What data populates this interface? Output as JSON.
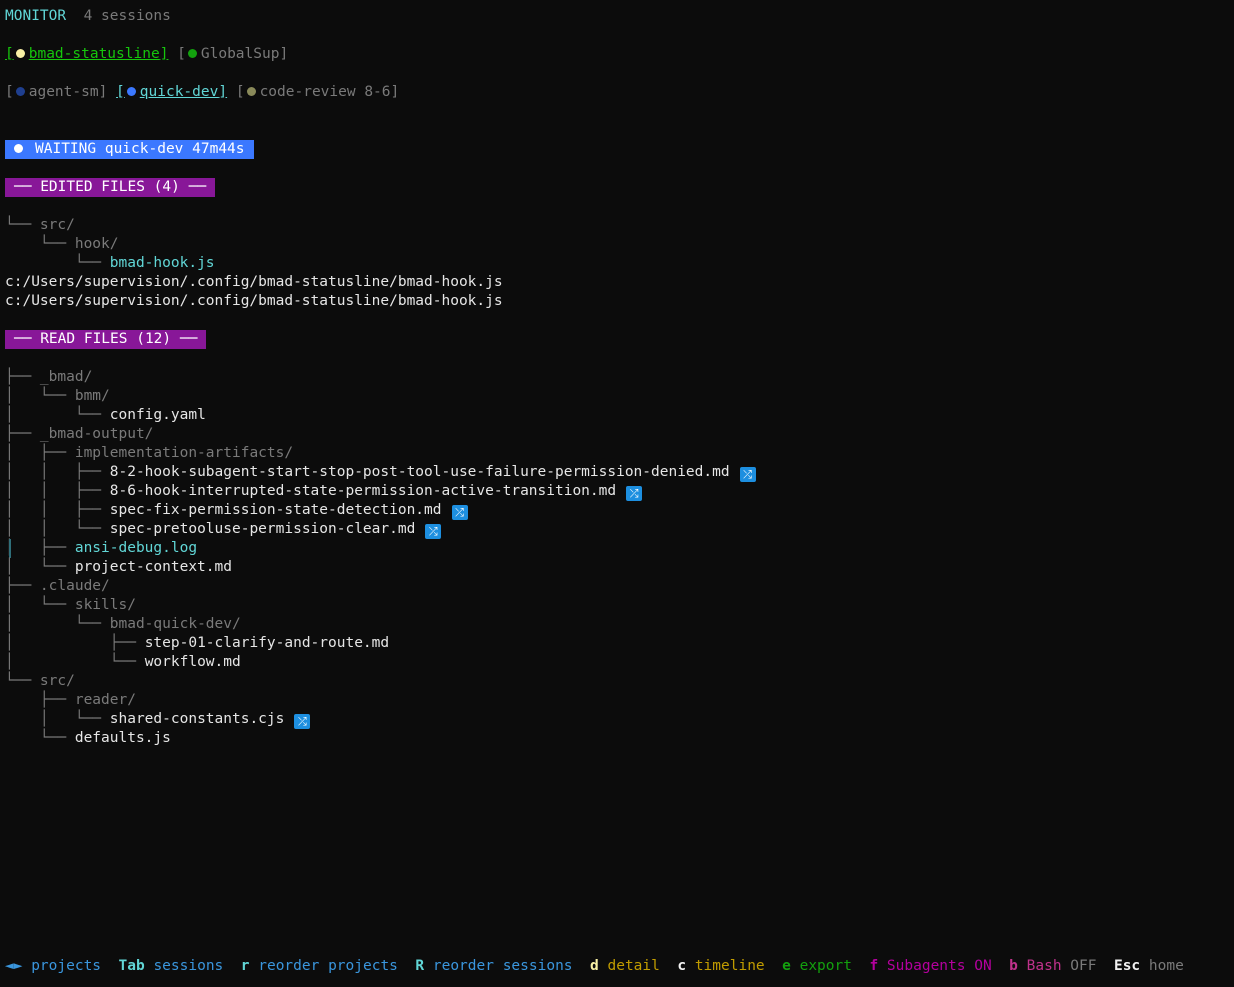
{
  "header": {
    "title": "MONITOR",
    "sessions_count": "4 sessions"
  },
  "projects": [
    {
      "label": "bmad-statusline",
      "dot_color": "#f9f1a5",
      "active": true
    },
    {
      "label": "GlobalSup",
      "dot_color": "#13a10e",
      "active": false
    }
  ],
  "sessions": [
    {
      "label": "agent-sm",
      "dot_color": "#1f3f8f",
      "active": false
    },
    {
      "label": "quick-dev",
      "dot_color": "#3b78ff",
      "active": true
    },
    {
      "label": "code-review 8-6",
      "dot_color": "#8a8a5a",
      "active": false
    }
  ],
  "status": {
    "text": "WAITING quick-dev 47m44s"
  },
  "edited": {
    "title": "── EDITED FILES (4) ──",
    "tree": [
      {
        "prefix": "└── ",
        "name": "src/",
        "kind": "dir"
      },
      {
        "prefix": "    └── ",
        "name": "hook/",
        "kind": "dir"
      },
      {
        "prefix": "        └── ",
        "name": "bmad-hook.js",
        "kind": "cyan"
      }
    ],
    "paths": [
      "c:/Users/supervision/.config/bmad-statusline/bmad-hook.js",
      "c:/Users/supervision/.config/bmad-statusline/bmad-hook.js"
    ]
  },
  "read": {
    "title": "── READ FILES (12) ──",
    "tree": [
      {
        "prefix": "├── ",
        "name": "_bmad/",
        "kind": "dir"
      },
      {
        "prefix": "│   └── ",
        "name": "bmm/",
        "kind": "dir"
      },
      {
        "prefix": "│       └── ",
        "name": "config.yaml",
        "kind": "file"
      },
      {
        "prefix": "├── ",
        "name": "_bmad-output/",
        "kind": "dir"
      },
      {
        "prefix": "│   ├── ",
        "name": "implementation-artifacts/",
        "kind": "dir"
      },
      {
        "prefix": "│   │   ├── ",
        "name": "8-2-hook-subagent-start-stop-post-tool-use-failure-permission-denied.md",
        "kind": "file",
        "badge": true
      },
      {
        "prefix": "│   │   ├── ",
        "name": "8-6-hook-interrupted-state-permission-active-transition.md",
        "kind": "file",
        "badge": true
      },
      {
        "prefix": "│   │   ├── ",
        "name": "spec-fix-permission-state-detection.md",
        "kind": "file",
        "badge": true
      },
      {
        "prefix": "│   │   └── ",
        "name": "spec-pretooluse-permission-clear.md",
        "kind": "file",
        "badge": true
      },
      {
        "prefix": "│   ├── ",
        "name": "ansi-debug.log",
        "kind": "cyan",
        "marker": true
      },
      {
        "prefix": "│   └── ",
        "name": "project-context.md",
        "kind": "file"
      },
      {
        "prefix": "├── ",
        "name": ".claude/",
        "kind": "dir"
      },
      {
        "prefix": "│   └── ",
        "name": "skills/",
        "kind": "dir"
      },
      {
        "prefix": "│       └── ",
        "name": "bmad-quick-dev/",
        "kind": "dir"
      },
      {
        "prefix": "│           ├── ",
        "name": "step-01-clarify-and-route.md",
        "kind": "file"
      },
      {
        "prefix": "│           └── ",
        "name": "workflow.md",
        "kind": "file"
      },
      {
        "prefix": "└── ",
        "name": "src/",
        "kind": "dir"
      },
      {
        "prefix": "    ├── ",
        "name": "reader/",
        "kind": "dir"
      },
      {
        "prefix": "    │   └── ",
        "name": "shared-constants.cjs",
        "kind": "file",
        "badge": true
      },
      {
        "prefix": "    └── ",
        "name": "defaults.js",
        "kind": "file"
      }
    ]
  },
  "badge_glyph": "⤮",
  "footer": [
    {
      "key": "◄►",
      "label": "projects",
      "key_color": "#3a96dd",
      "label_color": "#3a96dd"
    },
    {
      "key": "Tab",
      "label": "sessions",
      "key_color": "#61d6d6",
      "label_color": "#3a96dd"
    },
    {
      "key": "r",
      "label": "reorder projects",
      "key_color": "#61d6d6",
      "label_color": "#3a96dd"
    },
    {
      "key": "R",
      "label": "reorder sessions",
      "key_color": "#61d6d6",
      "label_color": "#3a96dd"
    },
    {
      "key": "d",
      "label": "detail",
      "key_color": "#f9f1a5",
      "label_color": "#c19c00"
    },
    {
      "key": "c",
      "label": "timeline",
      "key_color": "#f2f2f2",
      "label_color": "#c19c00"
    },
    {
      "key": "e",
      "label": "export",
      "key_color": "#13a10e",
      "label_color": "#13a10e"
    },
    {
      "key": "f",
      "label": "Subagents",
      "state": "ON",
      "key_color": "#b4009e",
      "label_color": "#b4009e",
      "state_color": "#b4009e"
    },
    {
      "key": "b",
      "label": "Bash",
      "state": "OFF",
      "key_color": "#c0328c",
      "label_color": "#c0328c",
      "state_color": "#7a7a7a"
    },
    {
      "key": "Esc",
      "label": "home",
      "key_color": "#f2f2f2",
      "label_color": "#7a7a7a"
    }
  ]
}
